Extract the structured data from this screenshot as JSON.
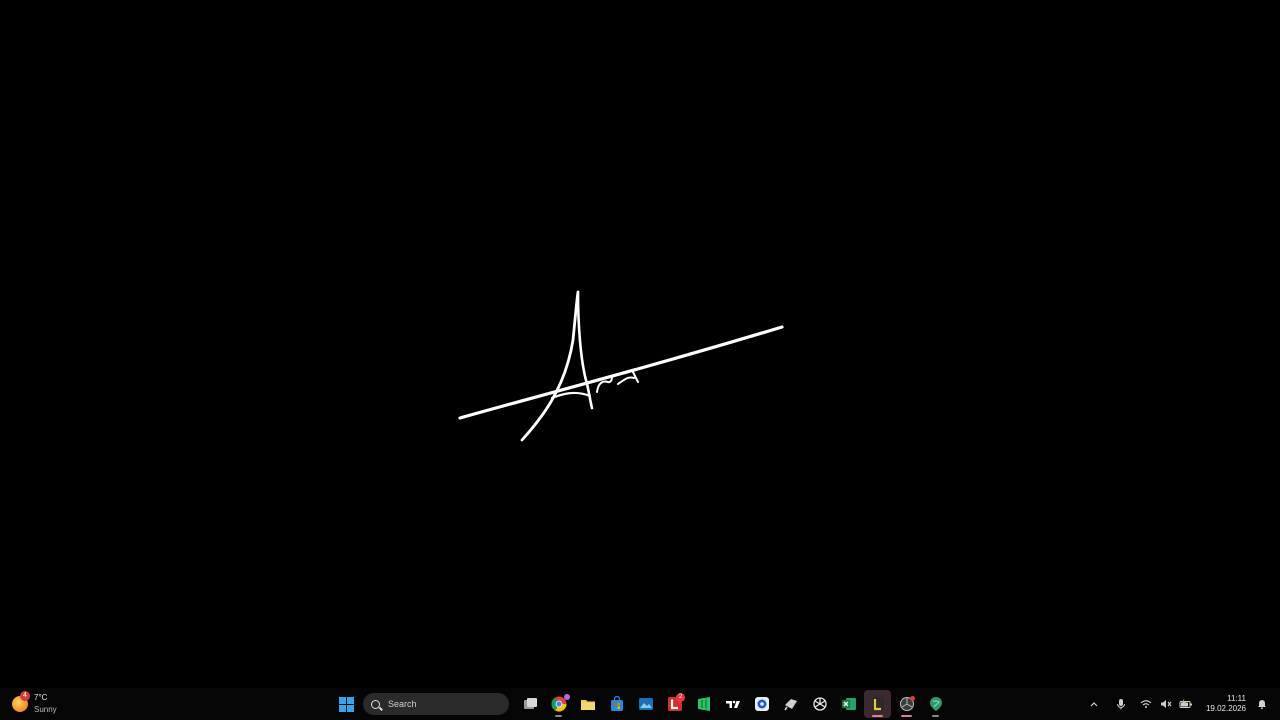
{
  "desktop": {
    "signature": "Art"
  },
  "taskbar": {
    "weather": {
      "temp": "7°C",
      "condition": "Sunny",
      "badge": "4",
      "icon": "sun-cloud-icon"
    },
    "search": {
      "placeholder": "Search"
    },
    "apps": [
      {
        "name": "task-view",
        "icon": "task-view-icon"
      },
      {
        "name": "chrome",
        "icon": "chrome-icon"
      },
      {
        "name": "file-explorer",
        "icon": "folder-icon"
      },
      {
        "name": "microsoft-store",
        "icon": "store-icon"
      },
      {
        "name": "photos",
        "icon": "photos-icon"
      },
      {
        "name": "l-app",
        "icon": "l-app-icon",
        "badge": "2"
      },
      {
        "name": "sheets-app",
        "icon": "green-app-icon"
      },
      {
        "name": "tradingview",
        "icon": "tradingview-icon",
        "label": "TV"
      },
      {
        "name": "settings-app",
        "icon": "blue-gear-icon"
      },
      {
        "name": "tools-app",
        "icon": "tools-icon"
      },
      {
        "name": "chatgpt",
        "icon": "chatgpt-icon"
      },
      {
        "name": "excel",
        "icon": "excel-icon"
      },
      {
        "name": "active-app",
        "icon": "yellow-app-icon"
      },
      {
        "name": "recorder-app",
        "icon": "recorder-icon"
      },
      {
        "name": "map-app",
        "icon": "globe-icon"
      }
    ],
    "tray": {
      "clock_time": "11:11",
      "clock_date": "19.02.2026"
    }
  }
}
